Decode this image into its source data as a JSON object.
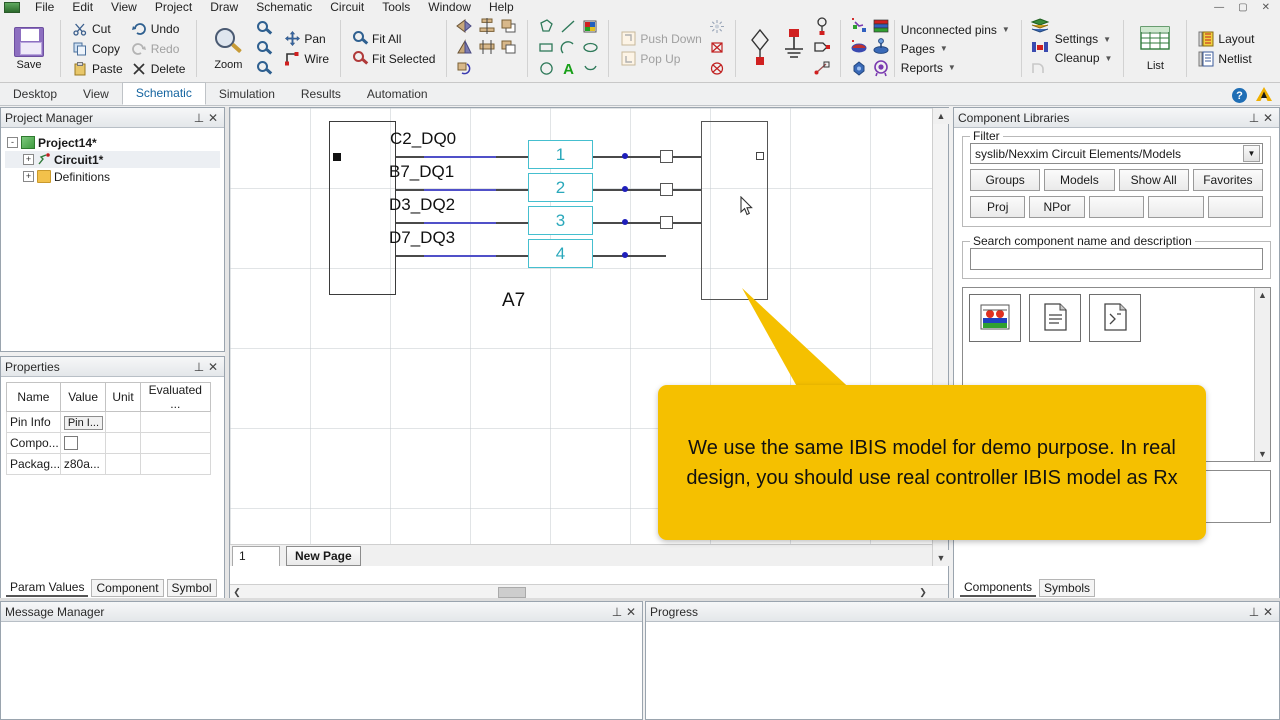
{
  "menu": {
    "items": [
      "File",
      "Edit",
      "View",
      "Project",
      "Draw",
      "Schematic",
      "Circuit",
      "Tools",
      "Window",
      "Help"
    ],
    "window_buttons": [
      "—",
      "▢",
      "✕"
    ]
  },
  "ribbon": {
    "save": {
      "label": "Save",
      "icon": "floppy-disk-icon"
    },
    "clipboard": [
      {
        "label": "Cut",
        "icon": "scissors-icon",
        "disabled": false
      },
      {
        "label": "Copy",
        "icon": "copy-icon",
        "disabled": false
      },
      {
        "label": "Paste",
        "icon": "paste-icon",
        "disabled": false
      }
    ],
    "history": [
      {
        "label": "Undo",
        "icon": "undo-arrow-icon",
        "disabled": false
      },
      {
        "label": "Redo",
        "icon": "redo-arrow-icon",
        "disabled": true
      },
      {
        "label": "Delete",
        "icon": "x-delete-icon",
        "disabled": false
      }
    ],
    "zoom": {
      "label": "Zoom",
      "icon": "magnifier-icon"
    },
    "zoom_tools": [
      "zoom-in-icon",
      "zoom-out-icon",
      "zoom-fit-icon"
    ],
    "nav": [
      {
        "label": "Pan",
        "icon": "pan-move-icon"
      },
      {
        "label": "Wire",
        "icon": "wire-draw-icon"
      }
    ],
    "fit": [
      {
        "label": "Fit All",
        "icon": "fit-all-icon"
      },
      {
        "label": "Fit Selected",
        "icon": "fit-selected-icon"
      }
    ],
    "arrange_icons": [
      "mirror-horizontal-icon",
      "align-center-horizontal-icon",
      "bring-forward-icon",
      "flip-vertical-icon",
      "align-center-vertical-icon",
      "send-backward-icon",
      "rotate-icon"
    ],
    "draw_icons": [
      "polygon-icon",
      "line-icon",
      "image-icon",
      "rectangle-icon",
      "arc-icon",
      "ellipse-icon",
      "circle-icon",
      "text-a-icon",
      "spline-icon"
    ],
    "hierarchy": [
      {
        "label": "Push Down",
        "icon": "push-down-icon",
        "disabled": true
      },
      {
        "label": "Pop Up",
        "icon": "pop-up-icon",
        "disabled": true
      }
    ],
    "port_icons": [
      "sparkle-icon",
      "delete-port-icon",
      "delete-all-ports-icon"
    ],
    "element_icons": [
      "diamond-node-icon",
      "ground-icon",
      "port-pin-icon",
      "output-port-icon",
      "probe-icon"
    ],
    "model_icons": [
      "add-component-icon",
      "stackup-icon",
      "edit-model-icon",
      "net-icon",
      "nport-icon",
      "target-icon"
    ],
    "dropdowns": [
      {
        "label": "Unconnected pins"
      },
      {
        "label": "Pages"
      },
      {
        "label": "Reports"
      }
    ],
    "settings_dropdowns": [
      {
        "label": "Settings",
        "icon": "layers-icon"
      },
      {
        "label": "Cleanup",
        "icon": "cleanup-icon"
      }
    ],
    "list": {
      "label": "List",
      "icon": "table-grid-icon"
    },
    "outputs": [
      {
        "label": "Layout",
        "icon": "layout-icon"
      },
      {
        "label": "Netlist",
        "icon": "netlist-icon"
      }
    ]
  },
  "tabs": {
    "items": [
      "Desktop",
      "View",
      "Schematic",
      "Simulation",
      "Results",
      "Automation"
    ],
    "active": "Schematic",
    "help_icon": "help-question-icon",
    "brand_icon": "ansys-logo-icon"
  },
  "project_manager": {
    "title": "Project Manager",
    "tree": [
      {
        "label": "Project14*",
        "expander": "-",
        "icon": "project-icon",
        "depth": 0,
        "bold": true
      },
      {
        "label": "Circuit1*",
        "expander": "+",
        "icon": "circuit-icon",
        "depth": 1,
        "bold": true
      },
      {
        "label": "Definitions",
        "expander": "+",
        "icon": "folder-icon",
        "depth": 1,
        "bold": false
      }
    ]
  },
  "properties": {
    "title": "Properties",
    "columns": [
      "Name",
      "Value",
      "Unit",
      "Evaluated ..."
    ],
    "rows": [
      {
        "name": "Pin Info",
        "value": "Pin I...",
        "unit": "",
        "evaluated": "",
        "kind": "button"
      },
      {
        "name": "Compo...",
        "value": "",
        "unit": "",
        "evaluated": "",
        "kind": "checkbox"
      },
      {
        "name": "Packag...",
        "value": "z80a...",
        "unit": "",
        "evaluated": "",
        "kind": "text"
      }
    ],
    "tabs": [
      {
        "label": "Param Values",
        "active": true
      },
      {
        "label": "Component",
        "active": false
      },
      {
        "label": "Symbol",
        "active": false
      }
    ]
  },
  "component_libraries": {
    "title": "Component Libraries",
    "filter": {
      "legend": "Filter",
      "selected": "syslib/Nexxim Circuit Elements/Models",
      "buttons_row1": [
        "Groups",
        "Models",
        "Show All",
        "Favorites"
      ],
      "buttons_row2": [
        "Proj",
        "NPor",
        "",
        "",
        ""
      ]
    },
    "search": {
      "legend": "Search component name and description",
      "value": "",
      "placeholder": ""
    },
    "items": [
      {
        "icon": "component-library-icon"
      },
      {
        "icon": "document-model-icon"
      },
      {
        "icon": "netlist-document-icon"
      }
    ],
    "tabs": [
      {
        "label": "Components",
        "active": true
      },
      {
        "label": "Symbols",
        "active": false
      }
    ]
  },
  "canvas": {
    "page_tab": "1",
    "new_page_label": "New Page",
    "schematic": {
      "reference_designator": "A7",
      "pins": [
        {
          "label": "C2_DQ0",
          "number": "1"
        },
        {
          "label": "B7_DQ1",
          "number": "2"
        },
        {
          "label": "D3_DQ2",
          "number": "3"
        },
        {
          "label": "D7_DQ3",
          "number": "4"
        }
      ]
    }
  },
  "callout": {
    "text": "We use the same IBIS model for demo purpose. In real design, you should use real controller IBIS model as Rx",
    "color": "#f5c000"
  },
  "docks": {
    "message_manager": {
      "title": "Message Manager"
    },
    "progress": {
      "title": "Progress"
    }
  }
}
